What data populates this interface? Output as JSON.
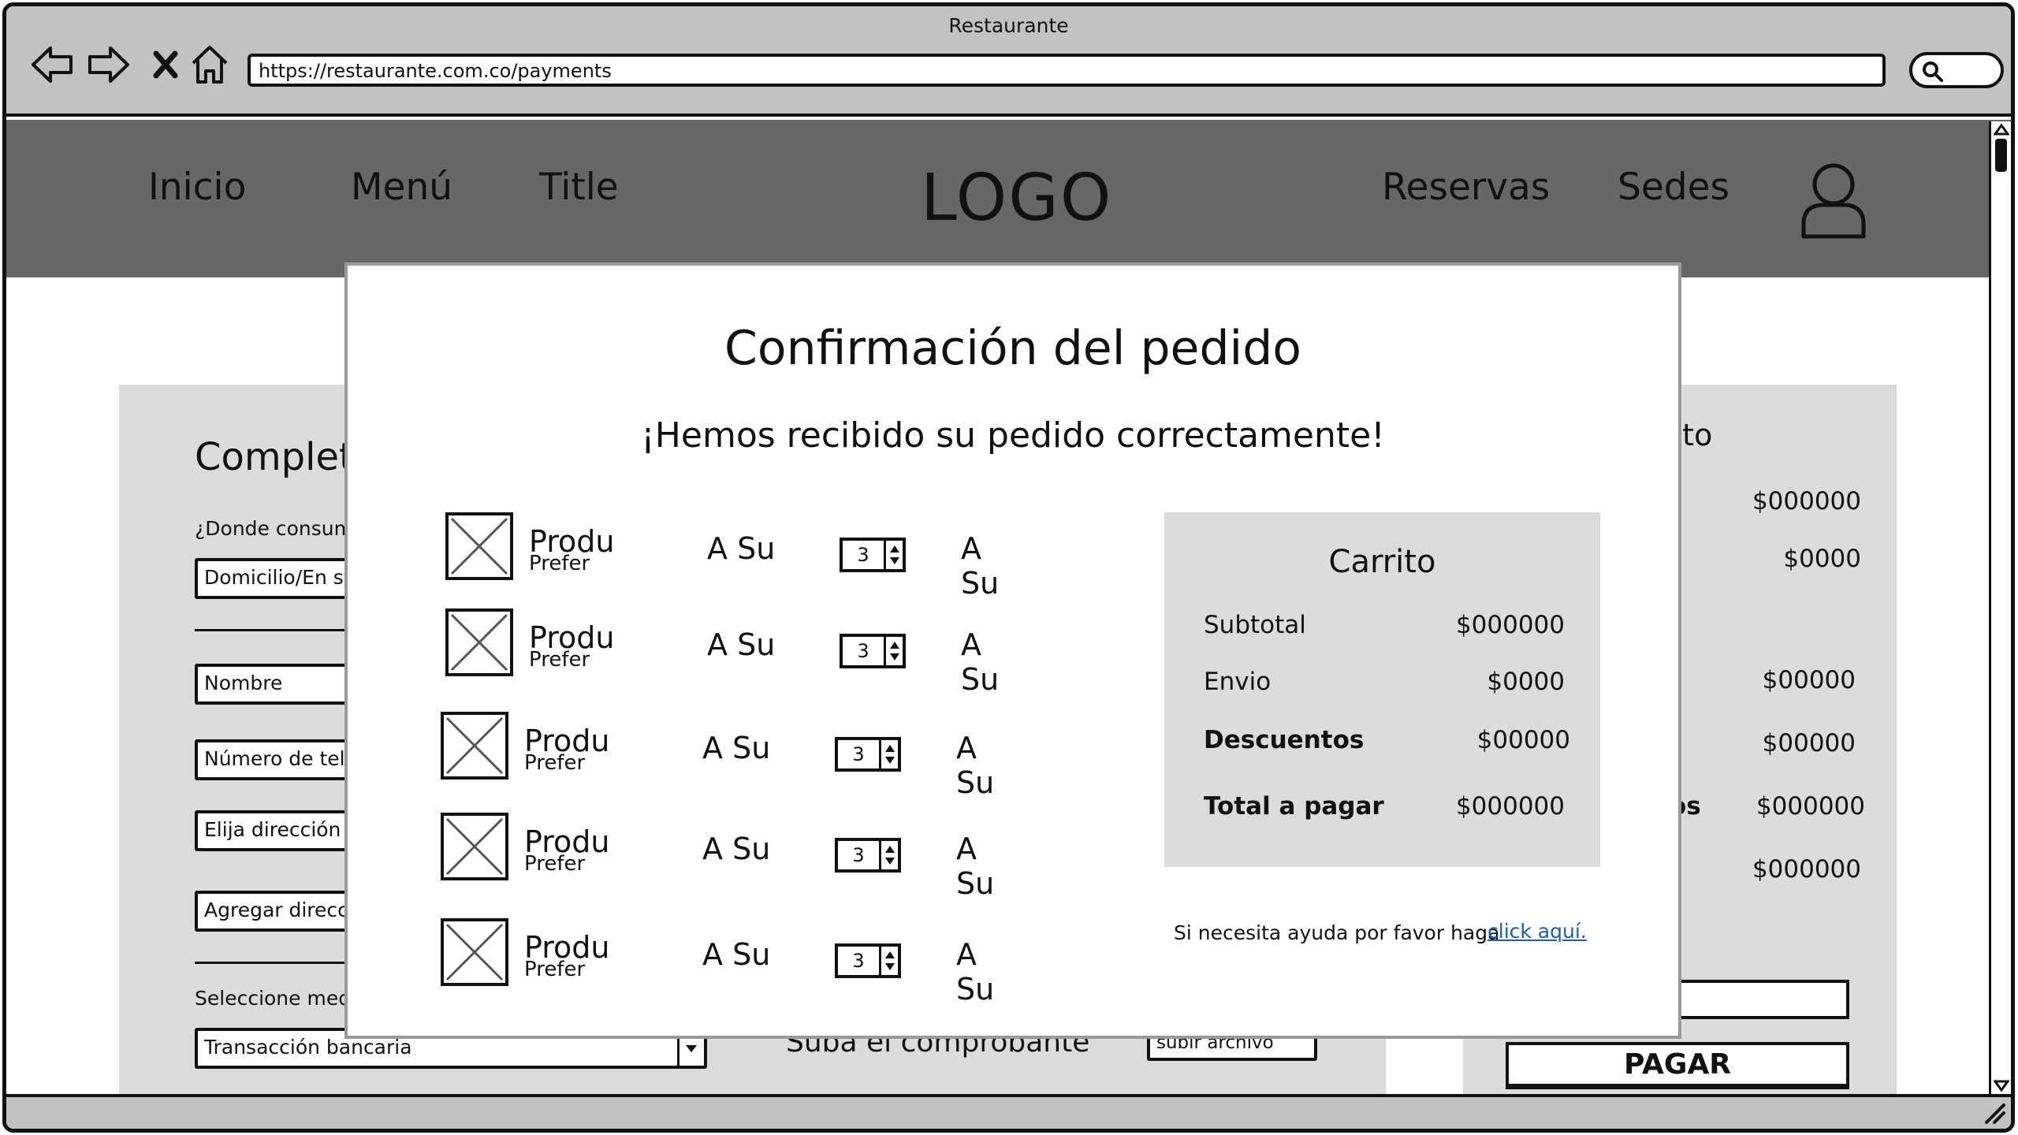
{
  "window": {
    "title": "Restaurante",
    "url": "https://restaurante.com.co/payments"
  },
  "nav": {
    "inicio": "Inicio",
    "menu": "Menú",
    "title": "Title",
    "logo": "LOGO",
    "reservas": "Reservas",
    "sedes": "Sedes"
  },
  "background_form": {
    "title": "Complete",
    "consume_label": "¿Donde consum",
    "consume_value": "Domicilio/En se",
    "name_placeholder": "Nombre",
    "phone_placeholder": "Número de telé",
    "address_select": "Elija dirección d",
    "add_address": "Agregar direcci",
    "payment_label": "Seleccione med",
    "payment_value": "Transacción bancaria",
    "upload_label": "Suba el comprobante",
    "upload_button": "subir archivo"
  },
  "background_cart": {
    "title_fragment": "rito",
    "values": [
      "$000000",
      "$0000",
      "$00000",
      "$00000",
      "$000000",
      "$000000"
    ],
    "label_fragment": "os",
    "pay_button": "PAGAR"
  },
  "modal": {
    "title": "Confirmación del pedido",
    "subtitle": "¡Hemos recibido su pedido correctamente!",
    "items": [
      {
        "name": "Produ",
        "desc": "Prefer",
        "col1": "A Su",
        "qty": "3",
        "col2": "A Su"
      },
      {
        "name": "Produ",
        "desc": "Prefer",
        "col1": "A Su",
        "qty": "3",
        "col2": "A Su"
      },
      {
        "name": "Produ",
        "desc": "Prefer",
        "col1": "A Su",
        "qty": "3",
        "col2": "A Su"
      },
      {
        "name": "Produ",
        "desc": "Prefer",
        "col1": "A Su",
        "qty": "3",
        "col2": "A Su"
      },
      {
        "name": "Produ",
        "desc": "Prefer",
        "col1": "A Su",
        "qty": "3",
        "col2": "A Su"
      }
    ],
    "cart": {
      "title": "Carrito",
      "subtotal_label": "Subtotal",
      "subtotal_value": "$000000",
      "envio_label": "Envio",
      "envio_value": "$0000",
      "descuentos_label": "Descuentos",
      "descuentos_value": "$00000",
      "total_label": "Total a pagar",
      "total_value": "$000000"
    },
    "help_text": "Si necesita ayuda por favor haga",
    "help_link": "click aquí."
  }
}
